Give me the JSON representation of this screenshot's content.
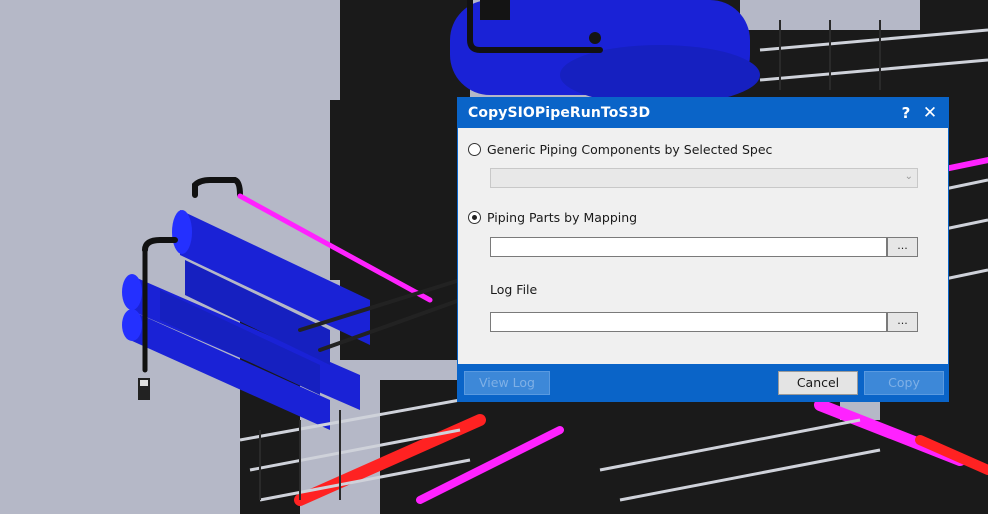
{
  "dialog": {
    "title": "CopySIOPipeRunToS3D",
    "help_label": "?",
    "close_label": "✕",
    "option_generic": {
      "label": "Generic Piping Components by Selected Spec",
      "selected": false
    },
    "spec_dropdown": {
      "value": "",
      "arrow": "⌄"
    },
    "option_mapping": {
      "label": "Piping Parts by Mapping",
      "selected": true
    },
    "mapping_file": {
      "value": "",
      "browse_label": "..."
    },
    "log_file": {
      "label": "Log File",
      "value": "",
      "browse_label": "..."
    },
    "buttons": {
      "view_log": "View Log",
      "cancel": "Cancel",
      "copy": "Copy"
    }
  },
  "colors": {
    "accent": "#0a64c8",
    "vessel_blue": "#1a22d6",
    "pipe_magenta": "#ff22ff",
    "pipe_red": "#ff2222",
    "background": "#b5b8c7"
  }
}
